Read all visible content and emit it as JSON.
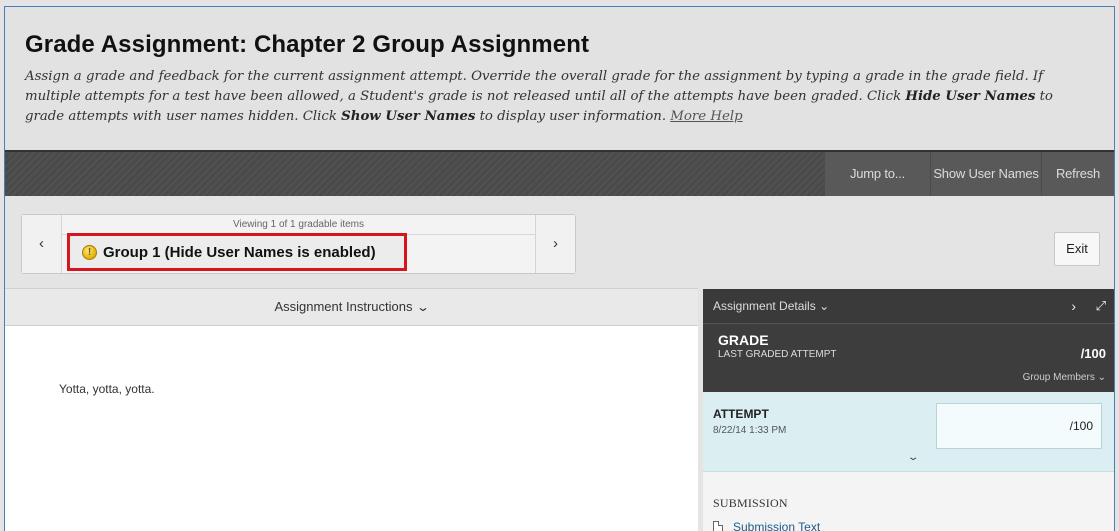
{
  "header": {
    "title": "Grade Assignment: Chapter 2 Group Assignment",
    "desc_1": "Assign a grade and feedback for the current assignment attempt. Override the overall grade for the assignment by typing a grade in the grade field. If multiple attempts for a test have been allowed, a Student's grade is not released until all of the attempts have been graded. Click ",
    "desc_hide": "Hide User Names",
    "desc_2": " to grade attempts with user names hidden. Click ",
    "desc_show": "Show User Names",
    "desc_3": " to display user information. ",
    "more_help": "More Help"
  },
  "toolbar": {
    "jump": "Jump to...",
    "show_user_names": "Show User Names",
    "refresh": "Refresh"
  },
  "navigator": {
    "prev": "‹",
    "next": "›",
    "viewing": "Viewing 1 of 1 gradable items",
    "group_label": "Group 1 (Hide User Names is enabled)"
  },
  "exit_label": "Exit",
  "instructions": {
    "label": "Assignment Instructions",
    "body": "Yotta, yotta, yotta."
  },
  "details": {
    "header": "Assignment Details",
    "grade_title": "GRADE",
    "grade_sub": "LAST GRADED ATTEMPT",
    "grade_value": "/100",
    "group_members": "Group Members",
    "attempt_title": "ATTEMPT",
    "attempt_date": "8/22/14 1:33 PM",
    "attempt_value": "/100",
    "submission_label": "SUBMISSION",
    "submission_link": "Submission Text"
  },
  "colors": {
    "highlight_border": "#d6161e",
    "toolbar_bg": "#4a4a4a",
    "attempt_bg": "#dbeef2"
  }
}
